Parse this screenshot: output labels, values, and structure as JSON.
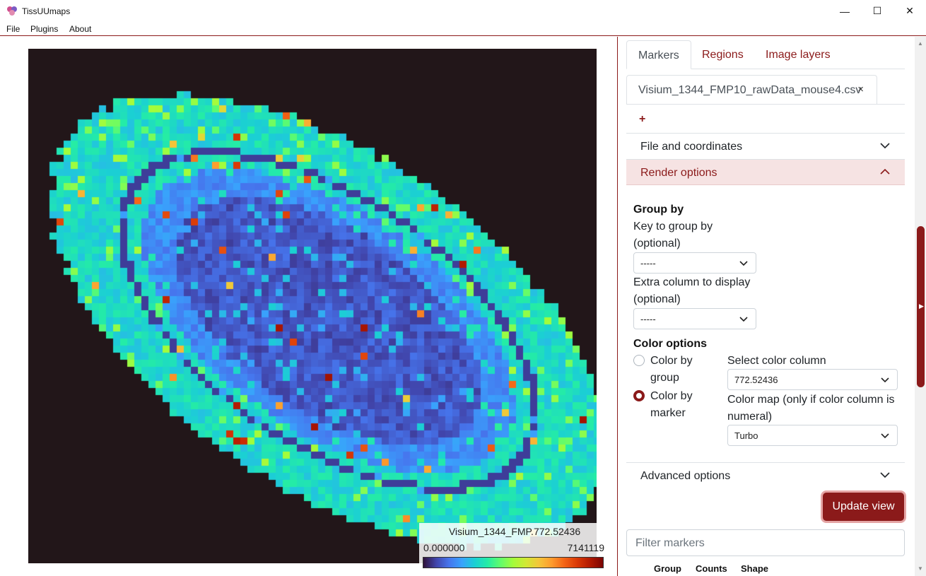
{
  "window": {
    "title": "TissUUmaps",
    "minimize": "—",
    "maximize": "☐",
    "close": "✕"
  },
  "menu": [
    "File",
    "Plugins",
    "About"
  ],
  "colorbar": {
    "title": "Visium_1344_FMP.772.52436",
    "min": "0.000000",
    "max": "7141119"
  },
  "tabs": [
    "Markers",
    "Regions",
    "Image layers"
  ],
  "file_tab": {
    "name": "Visium_1344_FMP10_rawData_mouse4.csv",
    "close": "×"
  },
  "add_tab": "+",
  "accordion": {
    "file_coords": "File and coordinates",
    "render": "Render options",
    "advanced": "Advanced options"
  },
  "group_by": {
    "heading": "Group by",
    "key_label_1": "Key to group by",
    "key_label_2": "(optional)",
    "key_value": "-----",
    "extra_label_1": "Extra column to display",
    "extra_label_2": "(optional)",
    "extra_value": "-----"
  },
  "color_options": {
    "heading": "Color options",
    "by_group_1": "Color by",
    "by_group_2": "group",
    "by_marker_1": "Color by",
    "by_marker_2": "marker",
    "select_col_label": "Select color column",
    "select_col_value": "772.52436",
    "cmap_label_1": "Color map (only if color column is",
    "cmap_label_2": "numeral)",
    "cmap_value": "Turbo",
    "selected": "marker"
  },
  "update_button": "Update view",
  "filter_placeholder": "Filter markers",
  "table_headers": [
    "Group",
    "Counts",
    "Shape"
  ],
  "accent_color": "#8b1a1a"
}
